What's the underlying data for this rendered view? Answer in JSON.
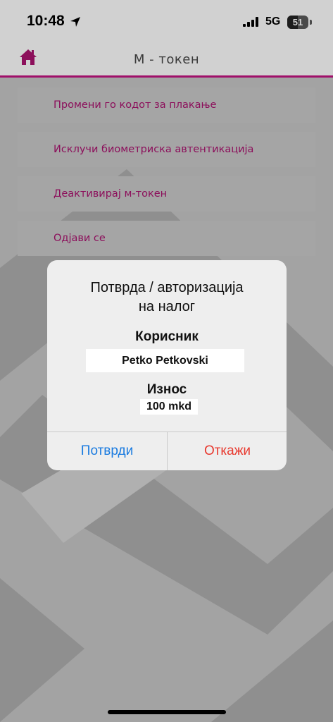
{
  "status_bar": {
    "time": "10:48",
    "network": "5G",
    "battery": "51"
  },
  "header": {
    "title": "M - токен",
    "accent_color": "#a0106a"
  },
  "menu": {
    "items": [
      {
        "label": "Промени го кодот за плакање"
      },
      {
        "label": "Исклучи биометриска автентикација"
      },
      {
        "label": "Деактивирај м-токен"
      },
      {
        "label": "Одјави се"
      }
    ]
  },
  "dialog": {
    "title_line1": "Потврда / авторизација",
    "title_line2": "на налог",
    "user_label": "Корисник",
    "user_value": "Petko Petkovski",
    "amount_label": "Износ",
    "amount_value": "100 mkd",
    "confirm_label": "Потврди",
    "cancel_label": "Откажи",
    "confirm_color": "#1a7be0",
    "cancel_color": "#e8392f"
  }
}
